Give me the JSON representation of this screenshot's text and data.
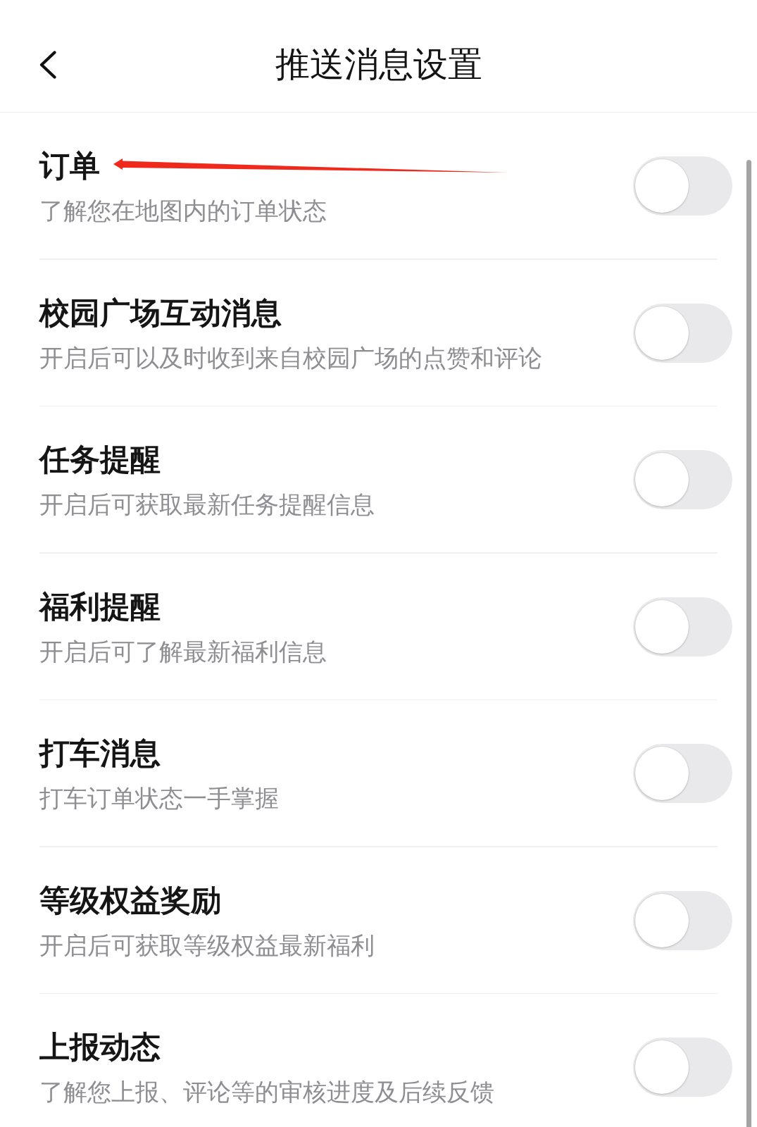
{
  "header": {
    "title": "推送消息设置"
  },
  "items": [
    {
      "title": "订单",
      "description": "了解您在地图内的订单状态",
      "on": false,
      "arrow": true
    },
    {
      "title": "校园广场互动消息",
      "description": "开启后可以及时收到来自校园广场的点赞和评论",
      "on": false,
      "arrow": false
    },
    {
      "title": "任务提醒",
      "description": "开启后可获取最新任务提醒信息",
      "on": false,
      "arrow": false
    },
    {
      "title": "福利提醒",
      "description": "开启后可了解最新福利信息",
      "on": false,
      "arrow": false
    },
    {
      "title": "打车消息",
      "description": "打车订单状态一手掌握",
      "on": false,
      "arrow": false
    },
    {
      "title": "等级权益奖励",
      "description": "开启后可获取等级权益最新福利",
      "on": false,
      "arrow": false
    },
    {
      "title": "上报动态",
      "description": "了解您上报、评论等的审核进度及后续反馈",
      "on": false,
      "arrow": false
    }
  ]
}
